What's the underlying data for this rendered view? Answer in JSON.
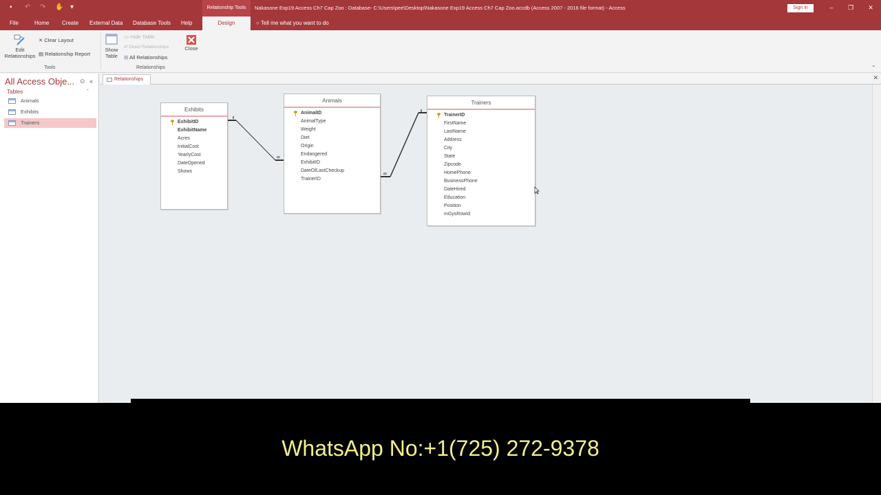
{
  "titlebar": {
    "context_tab": "Relationship Tools",
    "doc_title": "Nakasone Exp19 Access Ch7 Cap Zoo : Database- C:\\Users\\pee\\Desktop\\Nakasone Exp19 Access Ch7 Cap Zoo.accdb (Access 2007 - 2016 file format) - Access",
    "sign_in": "Sign in",
    "accent": "#a4373a"
  },
  "tabs": {
    "file": "File",
    "home": "Home",
    "create": "Create",
    "external": "External Data",
    "dbtools": "Database Tools",
    "help": "Help",
    "design": "Design",
    "tell_me": "Tell me what you want to do"
  },
  "ribbon": {
    "edit_relationships_1": "Edit",
    "edit_relationships_2": "Relationships",
    "clear_layout": "Clear Layout",
    "relationship_report": "Relationship Report",
    "tools_group": "Tools",
    "show_table_1": "Show",
    "show_table_2": "Table",
    "hide_table": "Hide Table",
    "direct_relationships": "Direct Relationships",
    "all_relationships": "All Relationships",
    "close": "Close",
    "relationships_group": "Relationships"
  },
  "nav": {
    "title": "All Access Obje...",
    "section": "Tables",
    "items": [
      {
        "label": "Animals",
        "selected": false
      },
      {
        "label": "Exhibits",
        "selected": false
      },
      {
        "label": "Trainers",
        "selected": true
      }
    ]
  },
  "doc_tab": "Relationships",
  "tables": {
    "exhibits": {
      "title": "Exhibits",
      "fields": [
        "ExhibitID",
        "ExhibitName",
        "Acres",
        "InitialCost",
        "YearlyCost",
        "DateOpened",
        "Shows"
      ]
    },
    "animals": {
      "title": "Animals",
      "fields": [
        "AnimalID",
        "AnimalType",
        "Weight",
        "Diet",
        "Origin",
        "Endangered",
        "ExhibitID",
        "DateOfLastCheckup",
        "TrainerID"
      ]
    },
    "trainers": {
      "title": "Trainers",
      "fields": [
        "TrainerID",
        "FirstName",
        "LastName",
        "Address",
        "City",
        "State",
        "Zipcode",
        "HomePhone",
        "BusinessPhone",
        "DateHired",
        "Education",
        "Position",
        "mGysRowId"
      ]
    }
  },
  "banner": {
    "text": "WhatsApp No:+1(725) 272-9378"
  }
}
